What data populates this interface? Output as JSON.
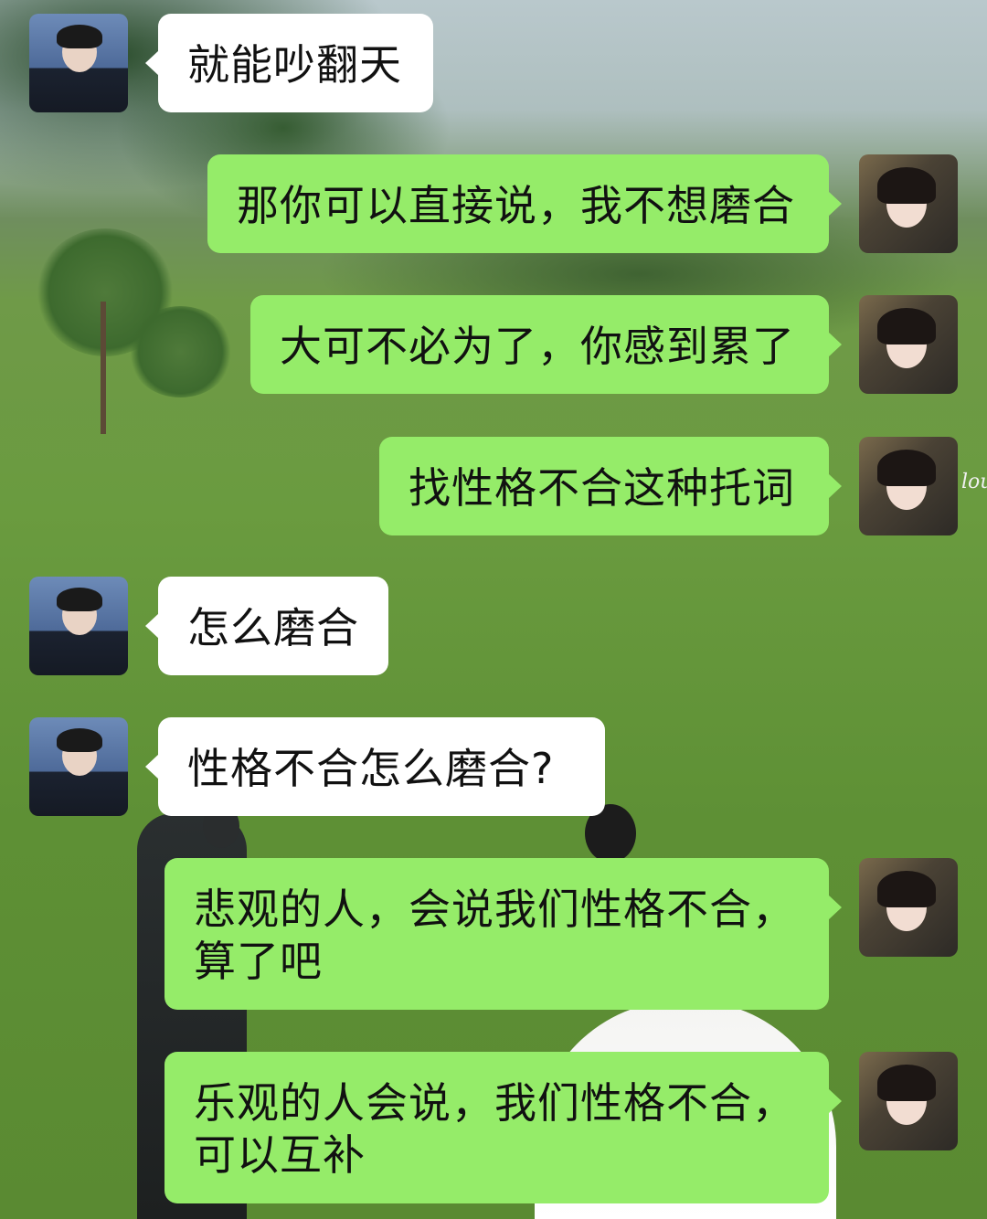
{
  "background_script_text": "lou",
  "messages": [
    {
      "side": "left",
      "sender": "male",
      "text": "就能吵翻天"
    },
    {
      "side": "right",
      "sender": "female",
      "text": "那你可以直接说，我不想磨合"
    },
    {
      "side": "right",
      "sender": "female",
      "text": "大可不必为了，你感到累了"
    },
    {
      "side": "right",
      "sender": "female",
      "text": "找性格不合这种托词"
    },
    {
      "side": "left",
      "sender": "male",
      "text": "怎么磨合"
    },
    {
      "side": "left",
      "sender": "male",
      "text": "性格不合怎么磨合?"
    },
    {
      "side": "right",
      "sender": "female",
      "text": "悲观的人，会说我们性格不合，\n算了吧"
    },
    {
      "side": "right",
      "sender": "female",
      "text": "乐观的人会说，我们性格不合，\n可以互补"
    }
  ],
  "colors": {
    "bubble_self": "#95ec69",
    "bubble_other": "#ffffff"
  }
}
